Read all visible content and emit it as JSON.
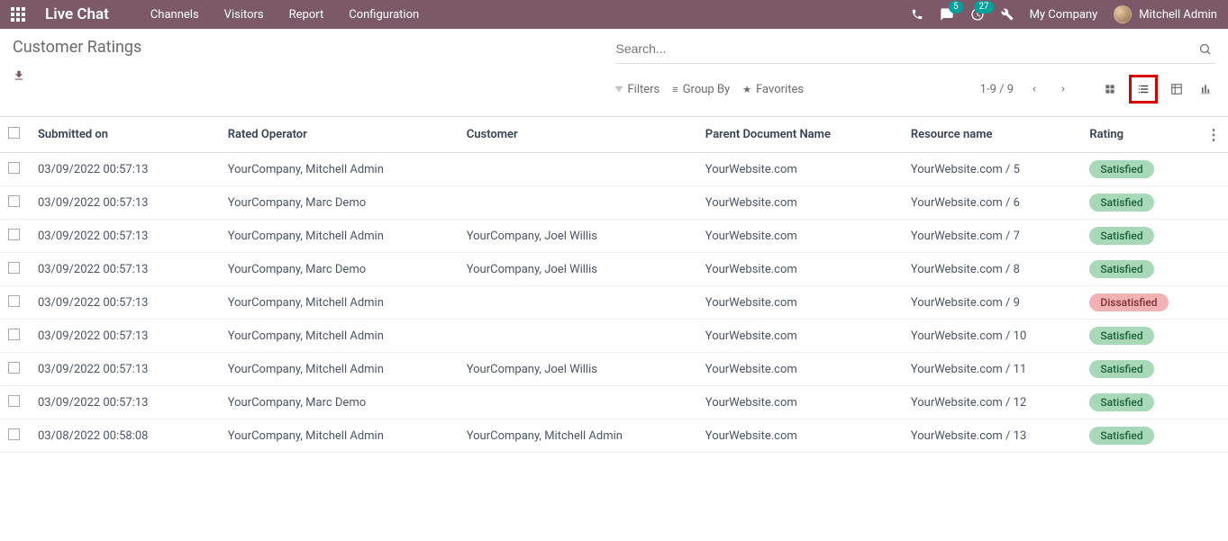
{
  "navbar": {
    "brand": "Live Chat",
    "menu": [
      "Channels",
      "Visitors",
      "Report",
      "Configuration"
    ],
    "chat_badge": "5",
    "activity_badge": "27",
    "company": "My Company",
    "user": "Mitchell Admin"
  },
  "page": {
    "title": "Customer Ratings",
    "search_placeholder": "Search..."
  },
  "filters": {
    "filters_label": "Filters",
    "groupby_label": "Group By",
    "favorites_label": "Favorites"
  },
  "pager": {
    "range": "1-9 / 9"
  },
  "columns": {
    "submitted": "Submitted on",
    "operator": "Rated Operator",
    "customer": "Customer",
    "parent": "Parent Document Name",
    "resource": "Resource name",
    "rating": "Rating"
  },
  "rows": [
    {
      "submitted": "03/09/2022 00:57:13",
      "operator": "YourCompany, Mitchell Admin",
      "customer": "",
      "parent": "YourWebsite.com",
      "resource": "YourWebsite.com / 5",
      "rating": "Satisfied",
      "rating_class": "satisfied"
    },
    {
      "submitted": "03/09/2022 00:57:13",
      "operator": "YourCompany, Marc Demo",
      "customer": "",
      "parent": "YourWebsite.com",
      "resource": "YourWebsite.com / 6",
      "rating": "Satisfied",
      "rating_class": "satisfied"
    },
    {
      "submitted": "03/09/2022 00:57:13",
      "operator": "YourCompany, Mitchell Admin",
      "customer": "YourCompany, Joel Willis",
      "parent": "YourWebsite.com",
      "resource": "YourWebsite.com / 7",
      "rating": "Satisfied",
      "rating_class": "satisfied"
    },
    {
      "submitted": "03/09/2022 00:57:13",
      "operator": "YourCompany, Marc Demo",
      "customer": "YourCompany, Joel Willis",
      "parent": "YourWebsite.com",
      "resource": "YourWebsite.com / 8",
      "rating": "Satisfied",
      "rating_class": "satisfied"
    },
    {
      "submitted": "03/09/2022 00:57:13",
      "operator": "YourCompany, Mitchell Admin",
      "customer": "",
      "parent": "YourWebsite.com",
      "resource": "YourWebsite.com / 9",
      "rating": "Dissatisfied",
      "rating_class": "dissatisfied"
    },
    {
      "submitted": "03/09/2022 00:57:13",
      "operator": "YourCompany, Mitchell Admin",
      "customer": "",
      "parent": "YourWebsite.com",
      "resource": "YourWebsite.com / 10",
      "rating": "Satisfied",
      "rating_class": "satisfied"
    },
    {
      "submitted": "03/09/2022 00:57:13",
      "operator": "YourCompany, Mitchell Admin",
      "customer": "YourCompany, Joel Willis",
      "parent": "YourWebsite.com",
      "resource": "YourWebsite.com / 11",
      "rating": "Satisfied",
      "rating_class": "satisfied"
    },
    {
      "submitted": "03/09/2022 00:57:13",
      "operator": "YourCompany, Marc Demo",
      "customer": "",
      "parent": "YourWebsite.com",
      "resource": "YourWebsite.com / 12",
      "rating": "Satisfied",
      "rating_class": "satisfied"
    },
    {
      "submitted": "03/08/2022 00:58:08",
      "operator": "YourCompany, Mitchell Admin",
      "customer": "YourCompany, Mitchell Admin",
      "parent": "YourWebsite.com",
      "resource": "YourWebsite.com / 13",
      "rating": "Satisfied",
      "rating_class": "satisfied"
    }
  ]
}
